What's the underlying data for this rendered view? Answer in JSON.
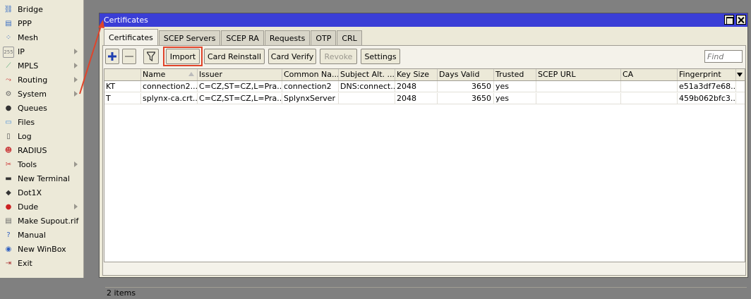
{
  "sidebar": {
    "items": [
      {
        "label": "Bridge",
        "icon": "bridge-icon",
        "glyph": "⛓",
        "color": "#3b6fc4",
        "submenu": false
      },
      {
        "label": "PPP",
        "icon": "ppp-icon",
        "glyph": "▤",
        "color": "#3b6fc4",
        "submenu": false
      },
      {
        "label": "Mesh",
        "icon": "mesh-icon",
        "glyph": "⁘",
        "color": "#3b6fc4",
        "submenu": false
      },
      {
        "label": "IP",
        "icon": "ip-icon",
        "glyph": "255",
        "color": "#777",
        "submenu": true
      },
      {
        "label": "MPLS",
        "icon": "mpls-icon",
        "glyph": "⟋",
        "color": "#5a7",
        "submenu": true
      },
      {
        "label": "Routing",
        "icon": "routing-icon",
        "glyph": "⤳",
        "color": "#c33",
        "submenu": true
      },
      {
        "label": "System",
        "icon": "system-gear-icon",
        "glyph": "⚙",
        "color": "#666",
        "submenu": true
      },
      {
        "label": "Queues",
        "icon": "queues-icon",
        "glyph": "●",
        "color": "#333",
        "submenu": false
      },
      {
        "label": "Files",
        "icon": "files-folder-icon",
        "glyph": "▭",
        "color": "#4a90d9",
        "submenu": false
      },
      {
        "label": "Log",
        "icon": "log-icon",
        "glyph": "▯",
        "color": "#555",
        "submenu": false
      },
      {
        "label": "RADIUS",
        "icon": "radius-users-icon",
        "glyph": "☻",
        "color": "#c44",
        "submenu": false
      },
      {
        "label": "Tools",
        "icon": "tools-icon",
        "glyph": "✂",
        "color": "#c33",
        "submenu": true
      },
      {
        "label": "New Terminal",
        "icon": "terminal-icon",
        "glyph": "▬",
        "color": "#333",
        "submenu": false
      },
      {
        "label": "Dot1X",
        "icon": "dot1x-icon",
        "glyph": "◆",
        "color": "#333",
        "submenu": false
      },
      {
        "label": "Dude",
        "icon": "dude-icon",
        "glyph": "●",
        "color": "#c22",
        "submenu": true
      },
      {
        "label": "Make Supout.rif",
        "icon": "supout-document-icon",
        "glyph": "▤",
        "color": "#666",
        "submenu": false
      },
      {
        "label": "Manual",
        "icon": "manual-help-icon",
        "glyph": "?",
        "color": "#2f5fc0",
        "submenu": false
      },
      {
        "label": "New WinBox",
        "icon": "winbox-icon",
        "glyph": "◉",
        "color": "#2f5fc0",
        "submenu": false
      },
      {
        "label": "Exit",
        "icon": "exit-icon",
        "glyph": "⇥",
        "color": "#a33",
        "submenu": false
      }
    ]
  },
  "window": {
    "title": "Certificates",
    "tabs": [
      "Certificates",
      "SCEP Servers",
      "SCEP RA",
      "Requests",
      "OTP",
      "CRL"
    ],
    "active_tab": 0,
    "toolbar": {
      "add_icon": "plus-icon",
      "remove_icon": "minus-icon",
      "filter_icon": "filter-icon",
      "import_label": "Import",
      "card_reinstall_label": "Card Reinstall",
      "card_verify_label": "Card Verify",
      "revoke_label": "Revoke",
      "settings_label": "Settings",
      "find_placeholder": "Find"
    },
    "table": {
      "columns": [
        "",
        "Name",
        "Issuer",
        "Common Na...",
        "Subject Alt. ...",
        "Key Size",
        "Days Valid",
        "Trusted",
        "SCEP URL",
        "CA",
        "Fingerprint"
      ],
      "rows": [
        [
          "KT",
          "connection2....",
          "C=CZ,ST=CZ,L=Pra...",
          "connection2",
          "DNS:connect...",
          "2048",
          "3650",
          "yes",
          "",
          "",
          "e51a3df7e68..."
        ],
        [
          "T",
          "splynx-ca.crt....",
          "C=CZ,ST=CZ,L=Pra...",
          "SplynxServer",
          "",
          "2048",
          "3650",
          "yes",
          "",
          "",
          "459b062bfc3..."
        ]
      ]
    },
    "status": "2 items"
  },
  "colors": {
    "titlebar": "#3a3ed6",
    "highlight": "#e0442a",
    "window_bg": "#ece9d8",
    "desktop_bg": "#808080"
  }
}
